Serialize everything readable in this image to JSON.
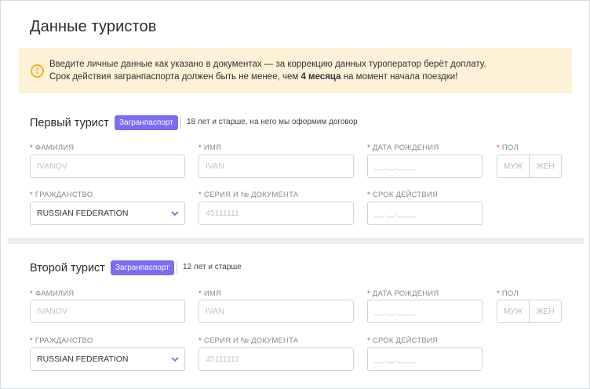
{
  "page": {
    "title": "Данные туристов"
  },
  "notice": {
    "icon": "info-icon",
    "line1": "Введите личные данные как указано в документах — за коррекцию данных туроператор берёт доплату.",
    "line2_before": "Срок действия загранпаспорта должен быть не менее, чем ",
    "line2_bold": "4 месяца",
    "line2_after": " на момент начала поездки!"
  },
  "colors": {
    "accent": "#7b6cf6",
    "required": "#e0392b",
    "notice_bg": "#fdf1d8",
    "notice_icon": "#f2b31b"
  },
  "labels": {
    "required_mark": "*",
    "last_name": "ФАМИЛИЯ",
    "first_name": "ИМЯ",
    "birth_date": "ДАТА РОЖДЕНИЯ",
    "gender": "ПОЛ",
    "citizenship": "ГРАЖДАНСТВО",
    "doc_number": "СЕРИЯ И № ДОКУМЕНТА",
    "expiry": "СРОК ДЕЙСТВИЯ"
  },
  "tourists": [
    {
      "title": "Первый турист",
      "doc_type": "Загранпаспорт",
      "note": "18 лет и старше, на него мы оформим договор",
      "last_name_placeholder": "IVANOV",
      "first_name_placeholder": "IVAN",
      "birth_date_placeholder": "__.__.____",
      "gender_options": [
        "МУЖ",
        "ЖЕН"
      ],
      "citizenship_value": "RUSSIAN FEDERATION",
      "doc_number_placeholder": "45111111",
      "expiry_placeholder": "__.__.____"
    },
    {
      "title": "Второй турист",
      "doc_type": "Загранпаспорт",
      "note": "12 лет и старше",
      "last_name_placeholder": "IVANOV",
      "first_name_placeholder": "IVAN",
      "birth_date_placeholder": "__.__.____",
      "gender_options": [
        "МУЖ",
        "ЖЕН"
      ],
      "citizenship_value": "RUSSIAN FEDERATION",
      "doc_number_placeholder": "45111111",
      "expiry_placeholder": "__.__.____"
    }
  ]
}
